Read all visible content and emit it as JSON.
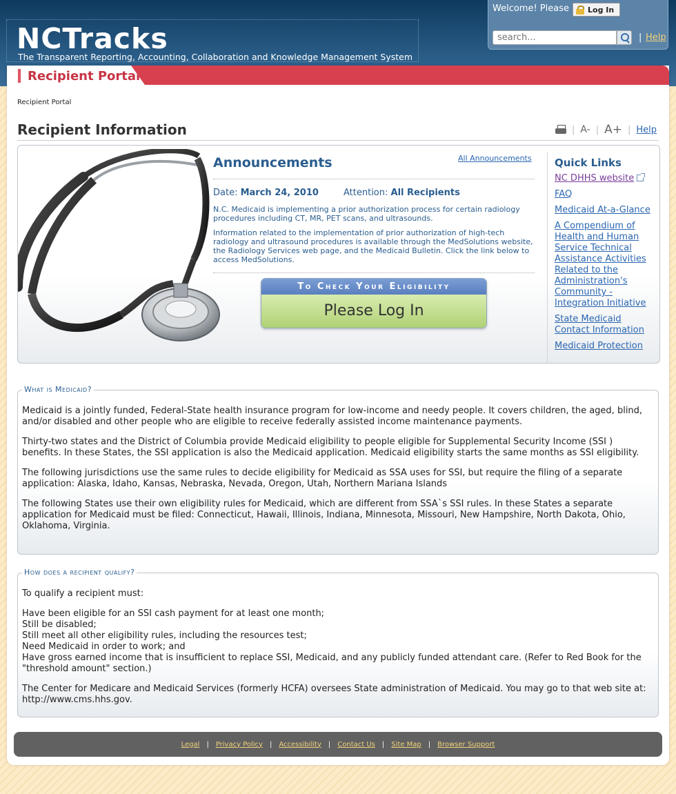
{
  "header": {
    "logo_title": "NCTracks",
    "logo_subtitle": "The Transparent Reporting, Accounting, Collaboration and Knowledge Management System",
    "welcome_text": "Welcome! Please",
    "login_label": "Log In",
    "search_placeholder": "search...",
    "help_label": "Help",
    "separator": "|"
  },
  "portal_tab": "Recipient Portal",
  "breadcrumb": "Recipient Portal",
  "page_title": "Recipient Information",
  "tools": {
    "font_decrease": "A-",
    "font_increase": "A+",
    "help_label": "Help"
  },
  "announcements": {
    "heading": "Announcements",
    "all_link": "All Announcements",
    "date_label": "Date:",
    "date_value": "March 24, 2010",
    "attention_label": "Attention:",
    "attention_value": "All Recipients",
    "paragraph1": "N.C. Medicaid is implementing a prior authorization process for certain radiology procedures including CT, MR, PET scans, and ultrasounds.",
    "paragraph2": "Information related to the implementation of prior authorization of high-tech radiology and ultrasound procedures is available through the MedSolutions website, the Radiology Services web page, and the Medicaid Bulletin. Click the link below to access MedSolutions.",
    "eligibility_header": "To Check Your Eligibility",
    "eligibility_button": "Please Log In"
  },
  "quick_links": {
    "title": "Quick Links",
    "items": [
      {
        "label": "NC DHHS website"
      },
      {
        "label": "FAQ"
      },
      {
        "label": "Medicaid At-a-Glance"
      },
      {
        "label": "A Compendium of Health and Human Service Technical Assistance Activities Related to the Administration's Community - Integration Initiative"
      },
      {
        "label": "State Medicaid Contact Information"
      },
      {
        "label": "Medicaid Protection"
      }
    ]
  },
  "what_is_medicaid": {
    "legend": "What is Medicaid?",
    "p1": "Medicaid is a jointly funded, Federal-State health insurance program for low-income and needy people. It covers children, the aged, blind, and/or disabled and other people who are eligible to receive federally assisted income maintenance payments.",
    "p2": "Thirty-two states and the District of Columbia provide Medicaid eligibility to people eligible for Supplemental Security Income (SSI ) benefits. In these States, the SSI application is also the Medicaid application. Medicaid eligibility starts the same months as SSI eligibility.",
    "p3": "The following jurisdictions use the same rules to decide eligibility for Medicaid as SSA uses for SSI, but require the filing of a separate application: Alaska, Idaho, Kansas, Nebraska, Nevada, Oregon, Utah, Northern Mariana Islands",
    "p4": "The following States use their own eligibility rules for Medicaid, which are different from SSA`s SSI rules. In these States a separate application for Medicaid must be filed: Connecticut, Hawaii, Illinois, Indiana, Minnesota, Missouri, New Hampshire, North Dakota, Ohio, Oklahoma, Virginia."
  },
  "qualify": {
    "legend": "How does a recipient qualify?",
    "intro": "To qualify a recipient must:",
    "requirements": [
      "Have been eligible for an SSI cash payment for at least one month;",
      "Still be disabled;",
      "Still meet all other eligibility rules, including the resources test;",
      "Need Medicaid in order to work; and",
      "Have gross earned income that is insufficient to replace SSI, Medicaid, and any publicly funded attendant care. (Refer to Red Book for the \"threshold amount\" section.)"
    ],
    "closing": "The Center for Medicare and Medicaid Services (formerly HCFA) oversees State administration of Medicaid. You may go to that web site at: http://www.cms.hhs.gov."
  },
  "footer": {
    "links": [
      "Legal",
      "Privacy Policy",
      "Accessibility",
      "Contact Us",
      "Site Map",
      "Browser Support"
    ],
    "separator": "|"
  },
  "colors": {
    "header_blue": "#1f4d75",
    "portal_red": "#d8404f",
    "link_blue": "#2a66b1",
    "footer_gray": "#616161",
    "background_cream": "#fdebc8"
  }
}
